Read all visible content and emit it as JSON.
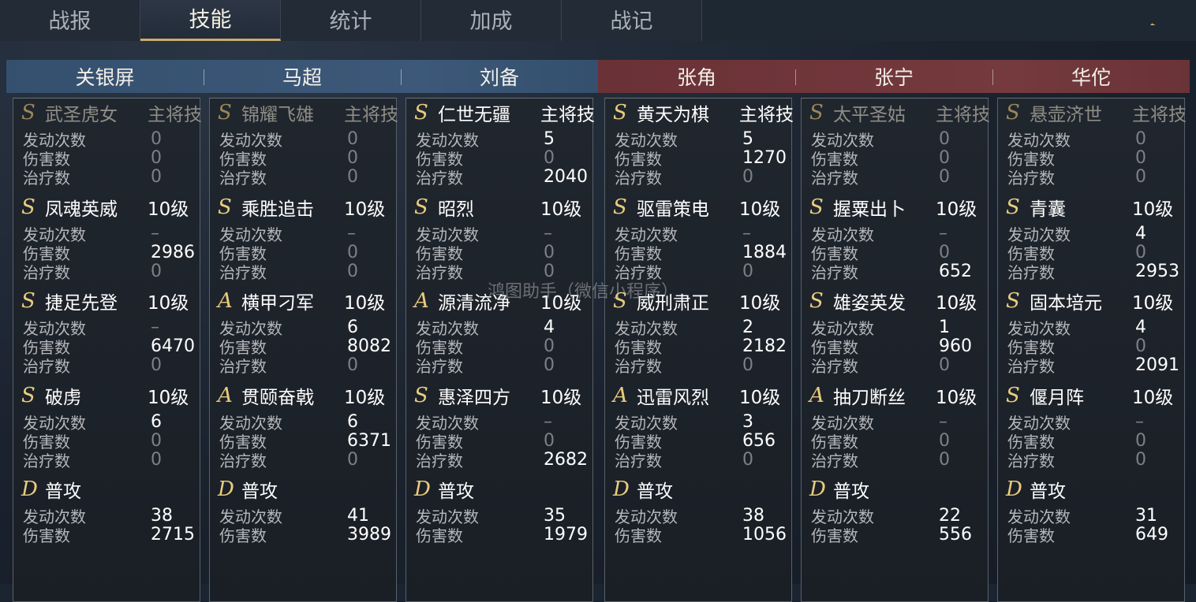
{
  "tabs": [
    "战报",
    "技能",
    "统计",
    "加成",
    "战记"
  ],
  "active_tab_index": 1,
  "teams": [
    {
      "side": "blue",
      "color": "#3a5676",
      "heroes": [
        "关银屏",
        "马超",
        "刘备"
      ]
    },
    {
      "side": "red",
      "color": "#713639",
      "heroes": [
        "张角",
        "张宁",
        "华佗"
      ]
    }
  ],
  "stat_labels": {
    "count": "发动次数",
    "damage": "伤害数",
    "heal": "治疗数"
  },
  "grade_colors": {
    "S": "#e9cc7e",
    "A": "#e9cc7e",
    "D": "#e9cc7e",
    "S_dim": "#9a8758"
  },
  "heroes": [
    {
      "name": "关银屏",
      "skills": [
        {
          "grade": "S",
          "name": "武圣虎女",
          "level": "主将技",
          "dim": true,
          "count": "0",
          "damage": "0",
          "heal": "0"
        },
        {
          "grade": "S",
          "name": "凤魂英威",
          "level": "10级",
          "count": "–",
          "damage": "2986",
          "heal": "0"
        },
        {
          "grade": "S",
          "name": "捷足先登",
          "level": "10级",
          "count": "–",
          "damage": "6470",
          "heal": "0"
        },
        {
          "grade": "S",
          "name": "破虏",
          "level": "10级",
          "count": "6",
          "damage": "0",
          "heal": "0"
        },
        {
          "grade": "D",
          "name": "普攻",
          "level": "",
          "count": "38",
          "damage": "2715"
        }
      ]
    },
    {
      "name": "马超",
      "skills": [
        {
          "grade": "S",
          "name": "锦耀飞雄",
          "level": "主将技",
          "dim": true,
          "count": "0",
          "damage": "0",
          "heal": "0"
        },
        {
          "grade": "S",
          "name": "乘胜追击",
          "level": "10级",
          "count": "–",
          "damage": "0",
          "heal": "0"
        },
        {
          "grade": "A",
          "name": "横甲刁军",
          "level": "10级",
          "count": "6",
          "damage": "8082",
          "heal": "0"
        },
        {
          "grade": "A",
          "name": "贯颐奋戟",
          "level": "10级",
          "count": "6",
          "damage": "6371",
          "heal": "0"
        },
        {
          "grade": "D",
          "name": "普攻",
          "level": "",
          "count": "41",
          "damage": "3989"
        }
      ]
    },
    {
      "name": "刘备",
      "skills": [
        {
          "grade": "S",
          "name": "仁世无疆",
          "level": "主将技",
          "count": "5",
          "damage": "0",
          "heal": "2040"
        },
        {
          "grade": "S",
          "name": "昭烈",
          "level": "10级",
          "count": "–",
          "damage": "0",
          "heal": "0"
        },
        {
          "grade": "A",
          "name": "源清流净",
          "level": "10级",
          "count": "4",
          "damage": "0",
          "heal": "0"
        },
        {
          "grade": "S",
          "name": "惠泽四方",
          "level": "10级",
          "count": "–",
          "damage": "0",
          "heal": "2682"
        },
        {
          "grade": "D",
          "name": "普攻",
          "level": "",
          "count": "35",
          "damage": "1979"
        }
      ]
    },
    {
      "name": "张角",
      "skills": [
        {
          "grade": "S",
          "name": "黄天为棋",
          "level": "主将技",
          "count": "5",
          "damage": "1270",
          "heal": "0"
        },
        {
          "grade": "S",
          "name": "驱雷策电",
          "level": "10级",
          "count": "–",
          "damage": "1884",
          "heal": "0"
        },
        {
          "grade": "S",
          "name": "威刑肃正",
          "level": "10级",
          "count": "2",
          "damage": "2182",
          "heal": "0"
        },
        {
          "grade": "A",
          "name": "迅雷风烈",
          "level": "10级",
          "count": "3",
          "damage": "656",
          "heal": "0"
        },
        {
          "grade": "D",
          "name": "普攻",
          "level": "",
          "count": "38",
          "damage": "1056"
        }
      ]
    },
    {
      "name": "张宁",
      "skills": [
        {
          "grade": "S",
          "name": "太平圣姑",
          "level": "主将技",
          "dim": true,
          "count": "0",
          "damage": "0",
          "heal": "0"
        },
        {
          "grade": "S",
          "name": "握粟出卜",
          "level": "10级",
          "count": "–",
          "damage": "0",
          "heal": "652"
        },
        {
          "grade": "S",
          "name": "雄姿英发",
          "level": "10级",
          "count": "1",
          "damage": "960",
          "heal": "0"
        },
        {
          "grade": "A",
          "name": "抽刀断丝",
          "level": "10级",
          "count": "–",
          "damage": "0",
          "heal": "0"
        },
        {
          "grade": "D",
          "name": "普攻",
          "level": "",
          "count": "22",
          "damage": "556"
        }
      ]
    },
    {
      "name": "华佗",
      "skills": [
        {
          "grade": "S",
          "name": "悬壶济世",
          "level": "主将技",
          "dim": true,
          "count": "0",
          "damage": "0",
          "heal": "0"
        },
        {
          "grade": "S",
          "name": "青囊",
          "level": "10级",
          "count": "4",
          "damage": "0",
          "heal": "2953"
        },
        {
          "grade": "S",
          "name": "固本培元",
          "level": "10级",
          "count": "4",
          "damage": "0",
          "heal": "2091"
        },
        {
          "grade": "S",
          "name": "偃月阵",
          "level": "10级",
          "count": "–",
          "damage": "0",
          "heal": "0"
        },
        {
          "grade": "D",
          "name": "普攻",
          "level": "",
          "count": "31",
          "damage": "649"
        }
      ]
    }
  ],
  "watermark": "鸿图助手（微信小程序）"
}
